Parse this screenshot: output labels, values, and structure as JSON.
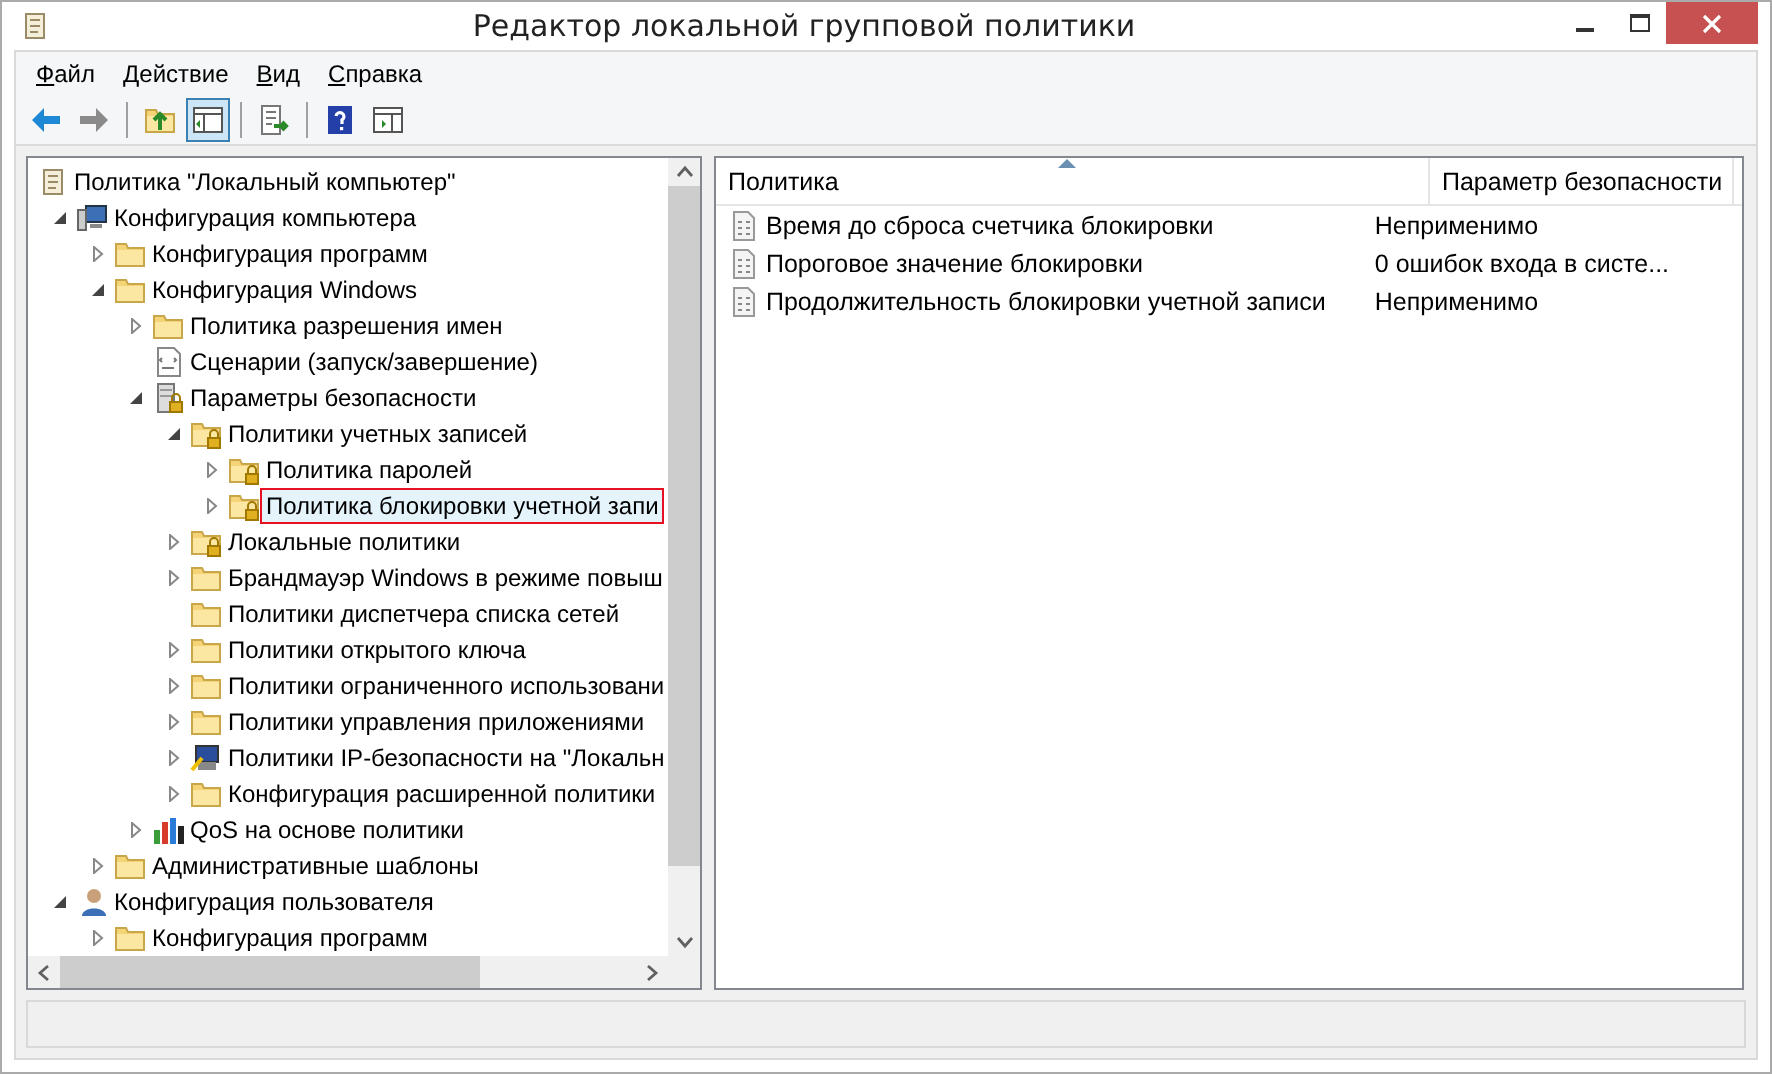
{
  "window": {
    "title": "Редактор локальной групповой политики"
  },
  "menu": [
    {
      "label": "Файл"
    },
    {
      "label": "Действие"
    },
    {
      "label": "Вид"
    },
    {
      "label": "Справка"
    }
  ],
  "toolbar": [
    {
      "kind": "back",
      "disabled": false,
      "pressed": false
    },
    {
      "kind": "forward",
      "disabled": true,
      "pressed": false
    },
    {
      "kind": "sep"
    },
    {
      "kind": "up",
      "pressed": false
    },
    {
      "kind": "tree",
      "pressed": true
    },
    {
      "kind": "sep"
    },
    {
      "kind": "export",
      "pressed": false
    },
    {
      "kind": "sep"
    },
    {
      "kind": "help",
      "pressed": false
    },
    {
      "kind": "actionpane",
      "pressed": false
    }
  ],
  "tree": [
    {
      "label": "Политика \"Локальный компьютер\"",
      "kind": "doc",
      "selected": false,
      "children": [
        {
          "label": "Конфигурация компьютера",
          "kind": "computer",
          "expanded": true,
          "selected": false,
          "children": [
            {
              "label": "Конфигурация программ",
              "kind": "folder",
              "expanded": false,
              "selected": false
            },
            {
              "label": "Конфигурация Windows",
              "kind": "folder",
              "expanded": true,
              "selected": false,
              "children": [
                {
                  "label": "Политика разрешения имен",
                  "kind": "folder",
                  "expanded": false,
                  "selected": false
                },
                {
                  "label": "Сценарии (запуск/завершение)",
                  "kind": "script",
                  "selected": false
                },
                {
                  "label": "Параметры безопасности",
                  "kind": "secserver",
                  "expanded": true,
                  "selected": false,
                  "children": [
                    {
                      "label": "Политики учетных записей",
                      "kind": "lockfolder",
                      "expanded": true,
                      "selected": false,
                      "children": [
                        {
                          "label": "Политика паролей",
                          "kind": "lockfolder",
                          "expanded": false,
                          "selected": false
                        },
                        {
                          "label": "Политика блокировки учетной запи",
                          "kind": "lockfolder",
                          "expanded": false,
                          "selected": true
                        }
                      ]
                    },
                    {
                      "label": "Локальные политики",
                      "kind": "lockfolder",
                      "expanded": false,
                      "selected": false
                    },
                    {
                      "label": "Брандмауэр Windows в режиме повыш",
                      "kind": "folder",
                      "expanded": false,
                      "selected": false
                    },
                    {
                      "label": "Политики диспетчера списка сетей",
                      "kind": "folder",
                      "selected": false
                    },
                    {
                      "label": "Политики открытого ключа",
                      "kind": "folder",
                      "expanded": false,
                      "selected": false
                    },
                    {
                      "label": "Политики ограниченного использовани",
                      "kind": "folder",
                      "expanded": false,
                      "selected": false
                    },
                    {
                      "label": "Политики управления приложениями",
                      "kind": "folder",
                      "expanded": false,
                      "selected": false
                    },
                    {
                      "label": "Политики IP-безопасности на \"Локальн",
                      "kind": "ippolicy",
                      "expanded": false,
                      "selected": false
                    },
                    {
                      "label": "Конфигурация расширенной политики",
                      "kind": "folder",
                      "expanded": false,
                      "selected": false
                    }
                  ]
                },
                {
                  "label": "QoS на основе политики",
                  "kind": "qos",
                  "expanded": false,
                  "selected": false
                }
              ]
            },
            {
              "label": "Административные шаблоны",
              "kind": "folder",
              "expanded": false,
              "selected": false
            }
          ]
        },
        {
          "label": "Конфигурация пользователя",
          "kind": "user",
          "expanded": true,
          "selected": false,
          "children": [
            {
              "label": "Конфигурация программ",
              "kind": "folder",
              "expanded": false,
              "selected": false
            }
          ]
        }
      ]
    }
  ],
  "list": {
    "columns": [
      {
        "label": "Политика",
        "sorted": true
      },
      {
        "label": "Параметр безопасности"
      }
    ],
    "rows": [
      {
        "policy": "Время до сброса счетчика блокировки",
        "setting": "Неприменимо"
      },
      {
        "policy": "Пороговое значение блокировки",
        "setting": "0 ошибок входа в систе..."
      },
      {
        "policy": "Продолжительность блокировки учетной записи",
        "setting": "Неприменимо"
      }
    ]
  }
}
